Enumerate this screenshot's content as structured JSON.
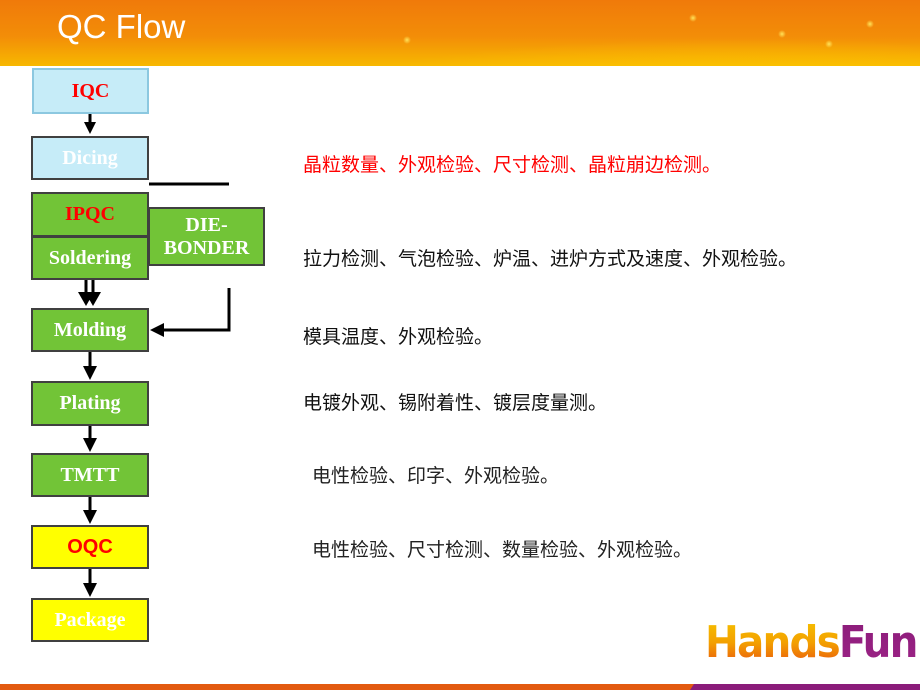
{
  "header": {
    "title": "QC Flow"
  },
  "flow": {
    "iqc": "IQC",
    "dicing": "Dicing",
    "ipqc": "IPQC",
    "soldering": "Soldering",
    "die_bonder": "DIE-\nBONDER",
    "die_bonder_line1": "DIE-",
    "die_bonder_line2": "BONDER",
    "molding": "Molding",
    "plating": "Plating",
    "tmtt": "TMTT",
    "oqc": "OQC",
    "package": "Package"
  },
  "descriptions": {
    "dicing": "晶粒数量、外观检验、尺寸检测、晶粒崩边检测。",
    "soldering": "拉力检测、气泡检验、炉温、进炉方式及速度、外观检验。",
    "molding": "模具温度、外观检验。",
    "plating": "电镀外观、锡附着性、镀层度量测。",
    "tmtt": "电性检验、印字、外观检验。",
    "oqc": "电性检验、尺寸检测、数量检验、外观检验。"
  },
  "logo": {
    "part1": "Hands",
    "part2": "Fun"
  },
  "colors": {
    "header_orange": "#f07a0a",
    "box_green": "#72c437",
    "box_cyan": "#c6ecf8",
    "box_yellow": "#ffff00",
    "highlight_red": "#ff0000",
    "brand_purple": "#8b1c7a"
  }
}
